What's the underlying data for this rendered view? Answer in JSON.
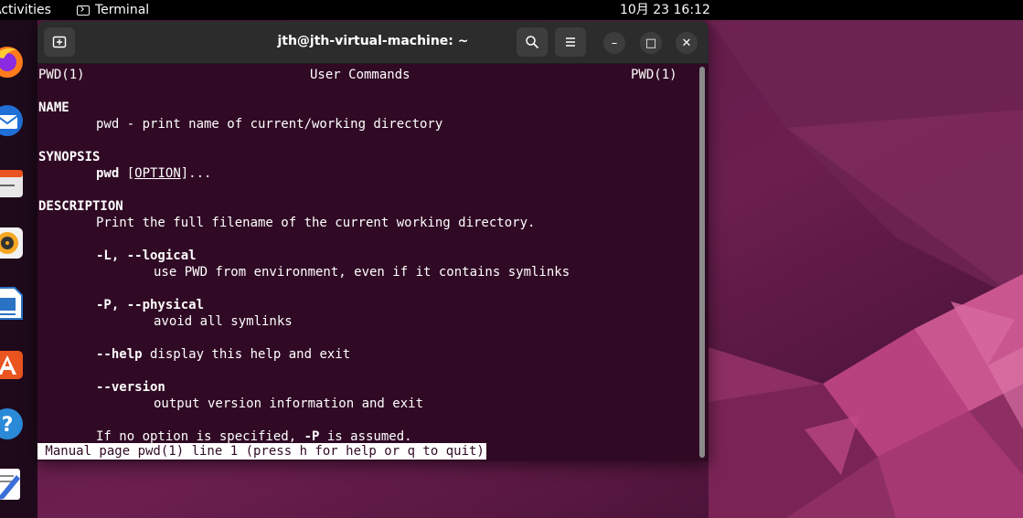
{
  "topbar": {
    "activities": "Activities",
    "app_name": "Terminal",
    "clock": "10月 23  16:12"
  },
  "dock": {
    "items": [
      {
        "name": "firefox",
        "icon": "firefox-icon"
      },
      {
        "name": "thunderbird",
        "icon": "thunderbird-icon"
      },
      {
        "name": "files",
        "icon": "files-icon"
      },
      {
        "name": "rhythmbox",
        "icon": "rhythmbox-icon"
      },
      {
        "name": "libreoffice-writer",
        "icon": "writer-icon"
      },
      {
        "name": "software",
        "icon": "software-icon"
      },
      {
        "name": "help",
        "icon": "help-icon"
      },
      {
        "name": "text-editor",
        "icon": "text-editor-icon"
      }
    ]
  },
  "window": {
    "title": "jth@jth-virtual-machine: ~",
    "new_tab_icon": "new-tab-icon",
    "search_icon": "search-icon",
    "menu_icon": "hamburger-menu-icon",
    "minimize_glyph": "–",
    "maximize_glyph": "□",
    "close_glyph": "✕"
  },
  "terminal": {
    "header_left": "PWD(1)",
    "header_center": "User Commands",
    "header_right": "PWD(1)",
    "name_heading": "NAME",
    "name_text": "pwd - print name of current/working directory",
    "synopsis_heading": "SYNOPSIS",
    "synopsis_cmd": "pwd",
    "synopsis_open": "[",
    "synopsis_option": "OPTION",
    "synopsis_rest": "]...",
    "description_heading": "DESCRIPTION",
    "description_text": "Print the full filename of the current working directory.",
    "opt_l": "-L, --logical",
    "opt_l_desc": "use PWD from environment, even if it contains symlinks",
    "opt_p": "-P, --physical",
    "opt_p_desc": "avoid all symlinks",
    "opt_help": "--help",
    "opt_help_desc": " display this help and exit",
    "opt_version": "--version",
    "opt_version_desc": "output version information and exit",
    "default_pre": "If no option is specified, ",
    "default_flag": "-P",
    "default_post": " is assumed.",
    "status": " Manual page pwd(1) line 1 (press h for help or q to quit)"
  },
  "colors": {
    "terminal_bg": "#300a24",
    "headerbar_bg": "#2c2c2c",
    "wallpaper_accent": "#b4357a"
  }
}
